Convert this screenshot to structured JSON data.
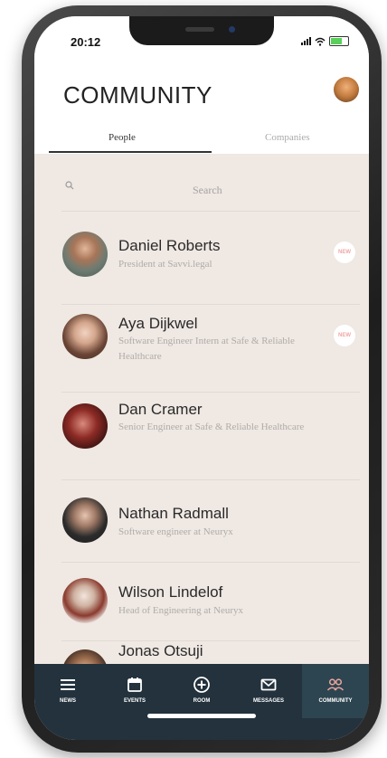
{
  "status": {
    "time": "20:12"
  },
  "header": {
    "title": "COMMUNITY"
  },
  "tabs": [
    {
      "label": "People"
    },
    {
      "label": "Companies"
    }
  ],
  "search": {
    "placeholder": "Search"
  },
  "people": [
    {
      "name": "Daniel Roberts",
      "role": "President at Savvi.legal",
      "badge": "NEW"
    },
    {
      "name": "Aya Dijkwel",
      "role": "Software Engineer Intern  at Safe & Reliable Healthcare",
      "badge": "NEW"
    },
    {
      "name": "Dan Cramer",
      "role": "Senior Engineer at Safe & Reliable Healthcare",
      "badge": ""
    },
    {
      "name": "Nathan Radmall",
      "role": "Software engineer  at Neuryx",
      "badge": ""
    },
    {
      "name": "Wilson Lindelof",
      "role": "Head of Engineering at Neuryx",
      "badge": ""
    },
    {
      "name": "Jonas Otsuji",
      "role": "",
      "badge": ""
    }
  ],
  "nav": [
    {
      "label": "NEWS",
      "icon": "menu-icon"
    },
    {
      "label": "EVENTS",
      "icon": "calendar-icon"
    },
    {
      "label": "ROOM",
      "icon": "plus-circle-icon"
    },
    {
      "label": "MESSAGES",
      "icon": "mail-icon"
    },
    {
      "label": "COMMUNITY",
      "icon": "people-icon"
    }
  ],
  "colors": {
    "nav_bg": "#23323d",
    "screen_bg": "#efe8e3",
    "badge_text": "#f0a6a6"
  }
}
